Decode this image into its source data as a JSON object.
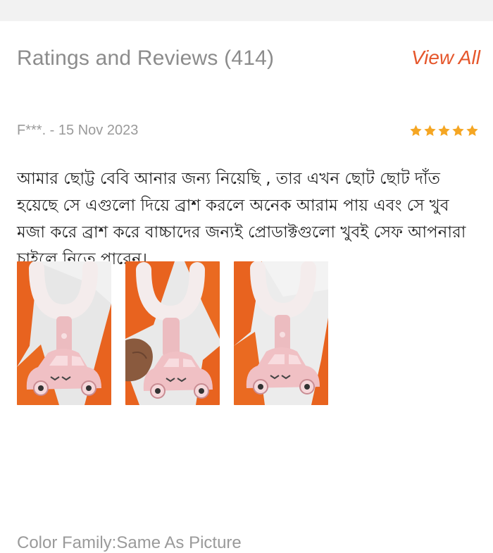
{
  "section": {
    "title": "Ratings and Reviews (414)",
    "view_all_label": "View All"
  },
  "review": {
    "author_date": "F***. - 15 Nov 2023",
    "rating": 5,
    "rating_max": 5,
    "text": "আমার ছোট্ট বেবি আনার জন্য নিয়েছি , তার এখন ছোট ছোট দাঁত হয়েছে সে এগুলো দিয়ে ব্রাশ করলে অনেক আরাম পায় এবং সে খুব মজা করে ব্রাশ করে বাচ্চাদের জন্যই প্রোডাক্টগুলো খুবই সেফ আপনারা চাইলে নিতে পারেন।",
    "photos": [
      {
        "alt": "product-photo-1"
      },
      {
        "alt": "product-photo-2"
      },
      {
        "alt": "product-photo-3"
      }
    ],
    "variant": "Color Family:Same As Picture"
  },
  "colors": {
    "accent": "#e5562b",
    "star": "#f5a623",
    "muted_text": "#9a9a9a",
    "body_text": "#222222",
    "photo_orange": "#e8631f",
    "toothbrush_pink": "#f0c0c4"
  }
}
